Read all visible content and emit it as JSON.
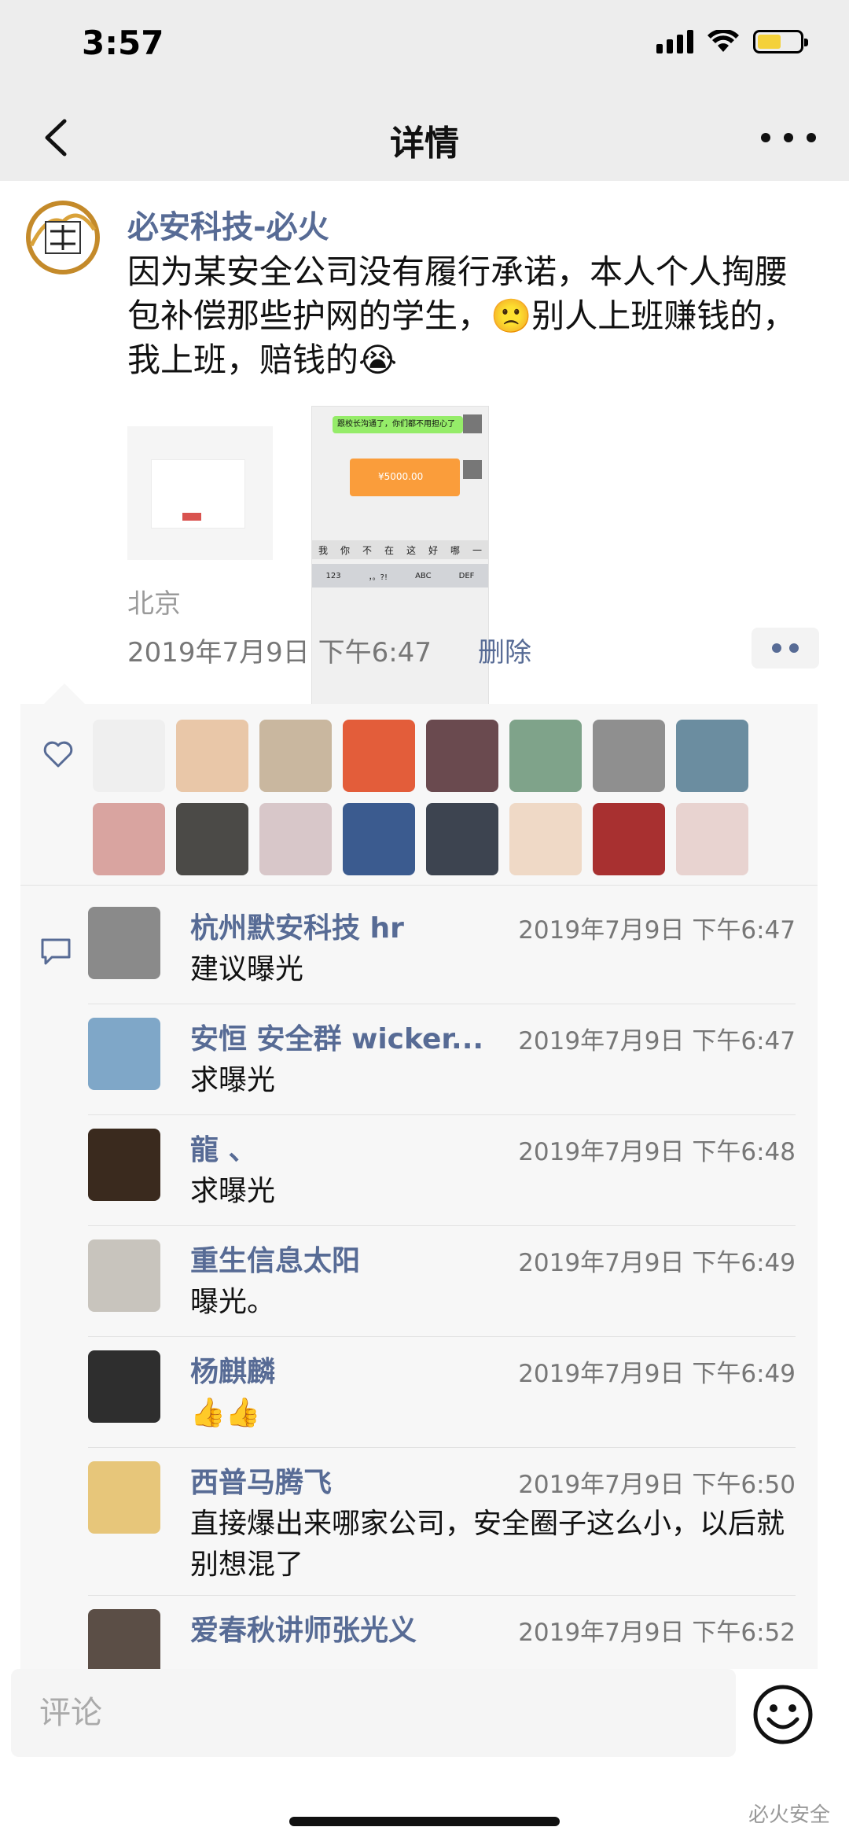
{
  "status": {
    "time": "3:57"
  },
  "nav": {
    "title": "详情"
  },
  "post": {
    "author": "必安科技-必火",
    "text": "因为某安全公司没有履行承诺，本人个人掏腰包补偿那些护网的学生，🙁别人上班赚钱的，我上班，赔钱的😭",
    "location": "北京",
    "timestamp": "2019年7月9日 下午6:47",
    "delete_label": "删除",
    "image_text": {
      "chat_bubble": "跟校长沟通了，你们都不用担心了",
      "amount": "¥5000.00",
      "keyboard_row": [
        "我",
        "你",
        "不",
        "在",
        "这",
        "好",
        "哪",
        "一"
      ],
      "keyboard_keys": [
        "123",
        "，。?!",
        "ABC",
        "DEF"
      ]
    }
  },
  "likes": {
    "colors": [
      "#efefef",
      "#e9c7a8",
      "#c9b79f",
      "#e35d3a",
      "#6a4a4f",
      "#7fa38a",
      "#8f8f8f",
      "#6b8da0",
      "#d9a4a0",
      "#4b4a47",
      "#d8c7c9",
      "#3b5b8f",
      "#3d4450",
      "#efd9c6",
      "#a83030",
      "#e8d3d0"
    ]
  },
  "comments": [
    {
      "name": "杭州默安科技 hr",
      "time": "2019年7月9日 下午6:47",
      "text": "建议曝光",
      "color": "#8a8a8a"
    },
    {
      "name": "安恒 安全群 wicker...",
      "time": "2019年7月9日 下午6:47",
      "text": "求曝光",
      "color": "#7fa7c8"
    },
    {
      "name": "龍 、",
      "time": "2019年7月9日 下午6:48",
      "text": "求曝光",
      "color": "#3a2a1e"
    },
    {
      "name": "重生信息太阳",
      "time": "2019年7月9日 下午6:49",
      "text": "曝光。",
      "color": "#c8c4bd"
    },
    {
      "name": "杨麒麟",
      "time": "2019年7月9日 下午6:49",
      "text": "👍👍",
      "color": "#2e2e2e"
    },
    {
      "name": "西普马腾飞",
      "time": "2019年7月9日 下午6:50",
      "text": "直接爆出来哪家公司，安全圈子这么小，以后就别想混了",
      "color": "#e7c67a"
    },
    {
      "name": "爱春秋讲师张光义",
      "time": "2019年7月9日 下午6:52",
      "text": "",
      "color": "#5b4e46"
    }
  ],
  "comment_bar": {
    "placeholder": "评论"
  },
  "watermark": "必火安全"
}
